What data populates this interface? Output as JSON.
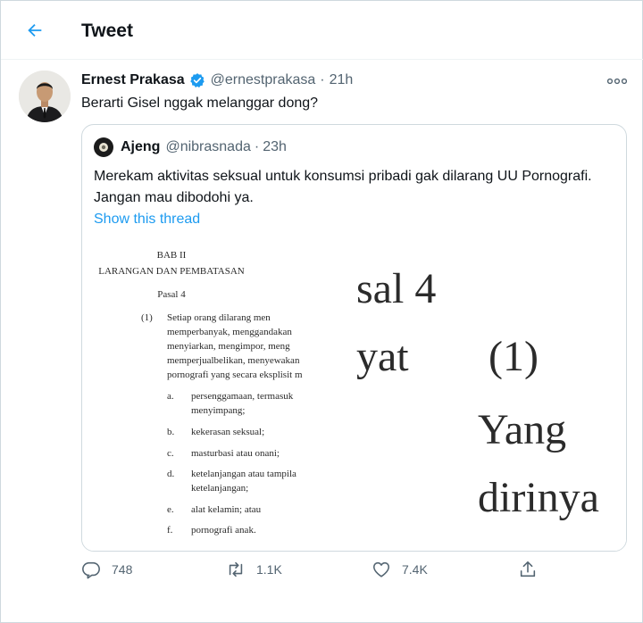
{
  "header": {
    "title": "Tweet"
  },
  "tweet": {
    "author_name": "Ernest Prakasa",
    "author_handle": "@ernestprakasa",
    "separator": "·",
    "time": "21h",
    "text": "Berarti Gisel nggak melanggar dong?"
  },
  "quote": {
    "author_name": "Ajeng",
    "author_handle": "@nibrasnada",
    "separator": "·",
    "time": "23h",
    "text": "Merekam aktivitas seksual untuk konsumsi pribadi gak dilarang UU Pornografi. Jangan mau dibodohi ya.",
    "show_thread": "Show this thread"
  },
  "media": {
    "doc": {
      "chapter": "BAB II",
      "chapter_title": "LARANGAN DAN PEMBATASAN",
      "article": "Pasal 4",
      "clause_num": "(1)",
      "clause_lines": [
        "Setiap    orang    dilarang    men",
        "memperbanyak,     menggandakan",
        "menyiarkan,  mengimpor,  meng",
        "memperjualbelikan,  menyewakan",
        "pornografi yang secara eksplisit m"
      ],
      "items": [
        {
          "letter": "a.",
          "text": "persenggamaan,   termasuk",
          "text2": "menyimpang;"
        },
        {
          "letter": "b.",
          "text": "kekerasan seksual;"
        },
        {
          "letter": "c.",
          "text": "masturbasi atau onani;"
        },
        {
          "letter": "d.",
          "text": "ketelanjangan  atau  tampila",
          "text2": "ketelanjangan;"
        },
        {
          "letter": "e.",
          "text": "alat kelamin; atau"
        },
        {
          "letter": "f.",
          "text": "pornografi anak."
        }
      ]
    },
    "zoom": {
      "line1": "sal 4",
      "line2a": "yat",
      "line2b": "(1)",
      "line3": "Yang",
      "line4": "dirinya"
    }
  },
  "actions": {
    "replies": "748",
    "retweets": "1.1K",
    "likes": "7.4K"
  },
  "colors": {
    "accent": "#1d9bf0",
    "muted": "#536471",
    "border": "#cfd9de"
  },
  "icons": [
    "back-arrow-icon",
    "verified-badge-icon",
    "more-icon",
    "reply-icon",
    "retweet-icon",
    "like-icon",
    "share-icon"
  ]
}
